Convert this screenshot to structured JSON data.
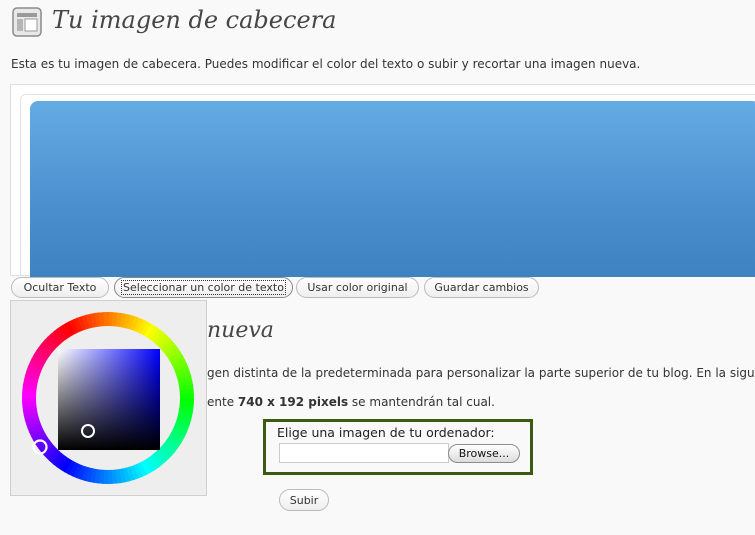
{
  "page": {
    "title": "Tu imagen de cabecera",
    "description": "Esta es tu imagen de cabecera. Puedes modificar el color del texto o subir y recortar una imagen nueva."
  },
  "header_buttons": {
    "hide_text": "Ocultar Texto",
    "select_color": "Seleccionar un color de texto",
    "original_color": "Usar color original",
    "save": "Guardar cambios"
  },
  "upload_section": {
    "title_fragment": "nueva",
    "line1_fragment": "gen distinta de la predeterminada para personalizar la parte superior de tu blog. En la siguiente",
    "line2_prefix": "ente ",
    "line2_bold": "740 x 192 pixels",
    "line2_suffix": " se mantendrán tal cual.",
    "choose_label": "Elige una imagen de tu ordenador:",
    "file_value": "",
    "browse_label": "Browse...",
    "submit_label": "Subir"
  },
  "color_picker": {
    "selected_hue_color": "#0000ff"
  }
}
